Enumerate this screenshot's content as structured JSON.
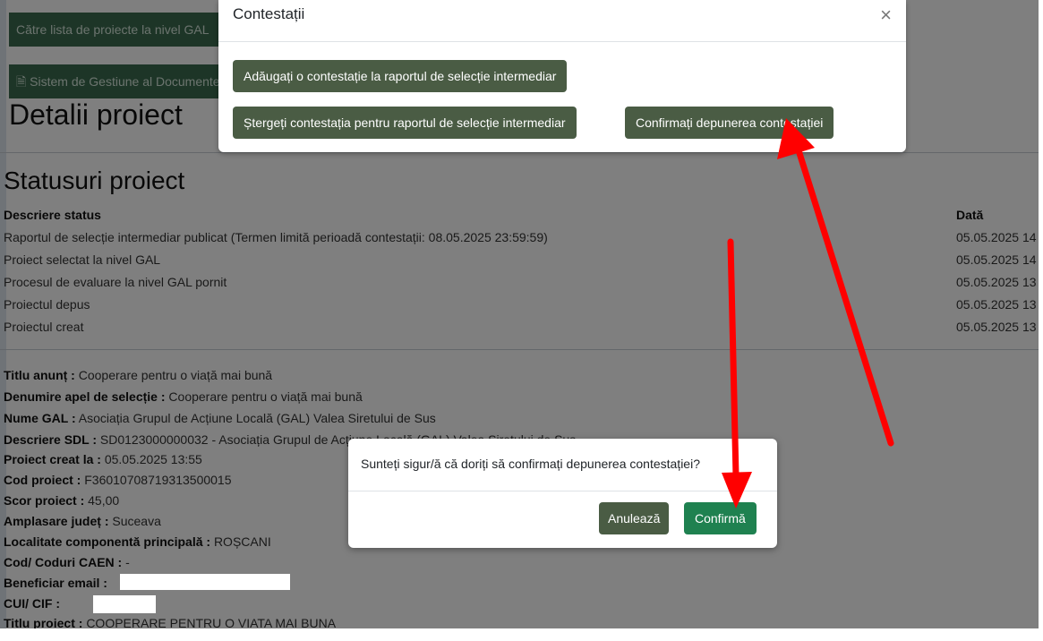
{
  "top_buttons": {
    "back_to_list": "Către lista de proiecte la nivel GAL",
    "document_system": "Sistem de Gestiune al Documentelor"
  },
  "page_title": "Detalii proiect",
  "statuses": {
    "title": "Statusuri proiect",
    "columns": [
      "Descriere status",
      "Dată"
    ],
    "rows": [
      {
        "description": "Raportul de selecție intermediar publicat (Termen limită perioadă contestații: 08.05.2025 23:59:59)",
        "date": "05.05.2025 14"
      },
      {
        "description": "Proiect selectat la nivel GAL",
        "date": "05.05.2025 14"
      },
      {
        "description": "Procesul de evaluare la nivel GAL pornit",
        "date": "05.05.2025 13"
      },
      {
        "description": "Proiectul depus",
        "date": "05.05.2025 13"
      },
      {
        "description": "Proiectul creat",
        "date": "05.05.2025 13"
      }
    ]
  },
  "details": [
    {
      "label": "Titlu anunț :",
      "value": "Cooperare pentru o viață mai bună"
    },
    {
      "label": "Denumire apel de selecție :",
      "value": "Cooperare pentru o viață mai bună"
    },
    {
      "label": "Nume GAL :",
      "value": "Asociația Grupul de Acțiune Locală (GAL) Valea Siretului de Sus"
    },
    {
      "label": "Descriere SDL :",
      "value": "SD0123000000032 - Asociația Grupul de Acțiune Locală (GAL) Valea Siretului de Sus"
    },
    {
      "label": "Proiect creat la :",
      "value": "05.05.2025 13:55"
    },
    {
      "label": "Cod proiect :",
      "value": "F36010708719313500015"
    },
    {
      "label": "Scor proiect :",
      "value": "45,00"
    },
    {
      "label": "Amplasare județ :",
      "value": "Suceava"
    },
    {
      "label": "Localitate componentă principală :",
      "value": "ROȘCANI"
    },
    {
      "label": "Cod/ Coduri CAEN :",
      "value": "-"
    },
    {
      "label": "Beneficiar email :",
      "value": ""
    },
    {
      "label": "CUI/ CIF :",
      "value": ""
    },
    {
      "label": "Titlu proiect :",
      "value": "COOPERARE PENTRU O VIATA MAI BUNA"
    }
  ],
  "modal_contestatii": {
    "title": "Contestații",
    "close": "×",
    "add_button": "Adăugați o contestație la raportul de selecție intermediar",
    "delete_button": "Ștergeți contestația pentru raportul de selecție intermediar",
    "confirm_button": "Confirmați depunerea contestației"
  },
  "modal_confirm": {
    "message": "Sunteți sigur/ă că doriți să confirmați depunerea contestației?",
    "cancel": "Anulează",
    "confirm": "Confirmă"
  },
  "colors": {
    "olive_button": "#4a5c44",
    "confirm_green": "#1f8150",
    "arrow_red": "#ff0000"
  },
  "icons": [
    "document-icon",
    "close-icon",
    "red-arrow-annotation"
  ]
}
